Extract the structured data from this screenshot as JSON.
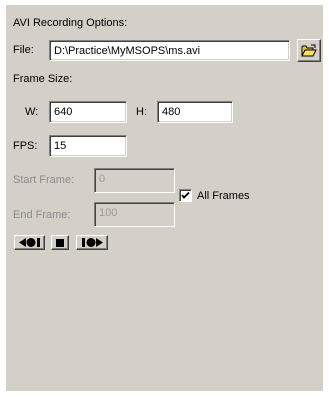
{
  "section_title": "AVI Recording Options:",
  "file": {
    "label": "File:",
    "value": "D:\\Practice\\MyMSOPS\\ms.avi",
    "browse_icon": "folder-open-icon"
  },
  "frame_size": {
    "label": "Frame Size:",
    "width_label": "W:",
    "width_value": "640",
    "height_label": "H:",
    "height_value": "480"
  },
  "fps": {
    "label": "FPS:",
    "value": "15"
  },
  "start_frame": {
    "label": "Start Frame:",
    "value": "0"
  },
  "end_frame": {
    "label": "End Frame:",
    "value": "100"
  },
  "all_frames": {
    "label": "All Frames",
    "checked": true
  },
  "playback_icons": [
    "step-back-icon",
    "stop-icon",
    "step-forward-icon"
  ]
}
